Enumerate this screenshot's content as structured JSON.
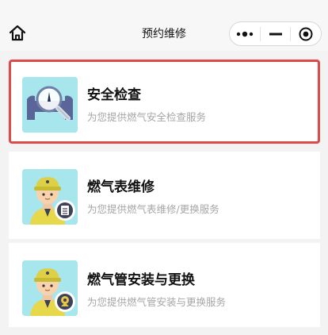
{
  "header": {
    "title": "预约维修",
    "home_icon": "home-icon",
    "capsule": {
      "more_icon": "more-dots-icon",
      "minimize_icon": "minimize-icon",
      "close_icon": "target-close-icon"
    }
  },
  "services": [
    {
      "title": "安全检查",
      "subtitle": "为您提供燃气安全检查服务",
      "icon": "magnifier-pipe-icon",
      "selected": true
    },
    {
      "title": "燃气表维修",
      "subtitle": "为您提供燃气表维修/更换服务",
      "icon": "worker-meter-icon",
      "selected": false
    },
    {
      "title": "燃气管安装与更换",
      "subtitle": "为您提供燃气管安装与更换服务",
      "icon": "worker-pipe-icon",
      "selected": false
    }
  ],
  "colors": {
    "selected_border": "#de4b49",
    "icon_bg": "#a7e6ec",
    "subtitle": "#a6a6a6"
  }
}
